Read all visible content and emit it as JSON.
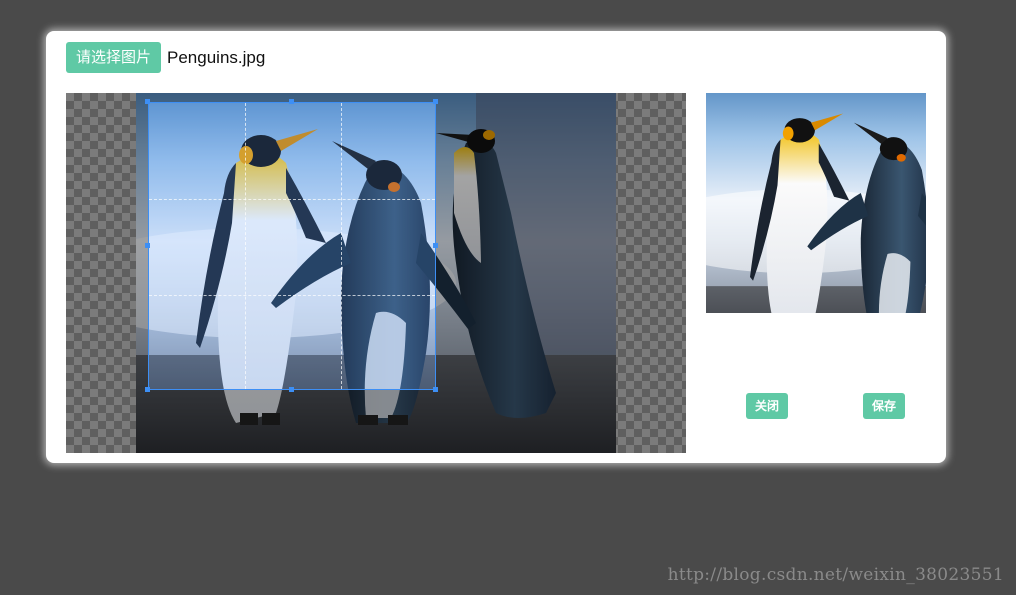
{
  "toolbar": {
    "select_image_label": "请选择图片",
    "file_name": "Penguins.jpg"
  },
  "actions": {
    "close_label": "关闭",
    "save_label": "保存"
  },
  "footer": {
    "watermark": "http://blog.csdn.net/weixin_38023551"
  },
  "colors": {
    "accent": "#5fc9a5",
    "crop_border": "#3d8ff5",
    "backdrop": "#4a4a4a"
  },
  "icons": {
    "checkerboard": "transparency-checkerboard"
  }
}
